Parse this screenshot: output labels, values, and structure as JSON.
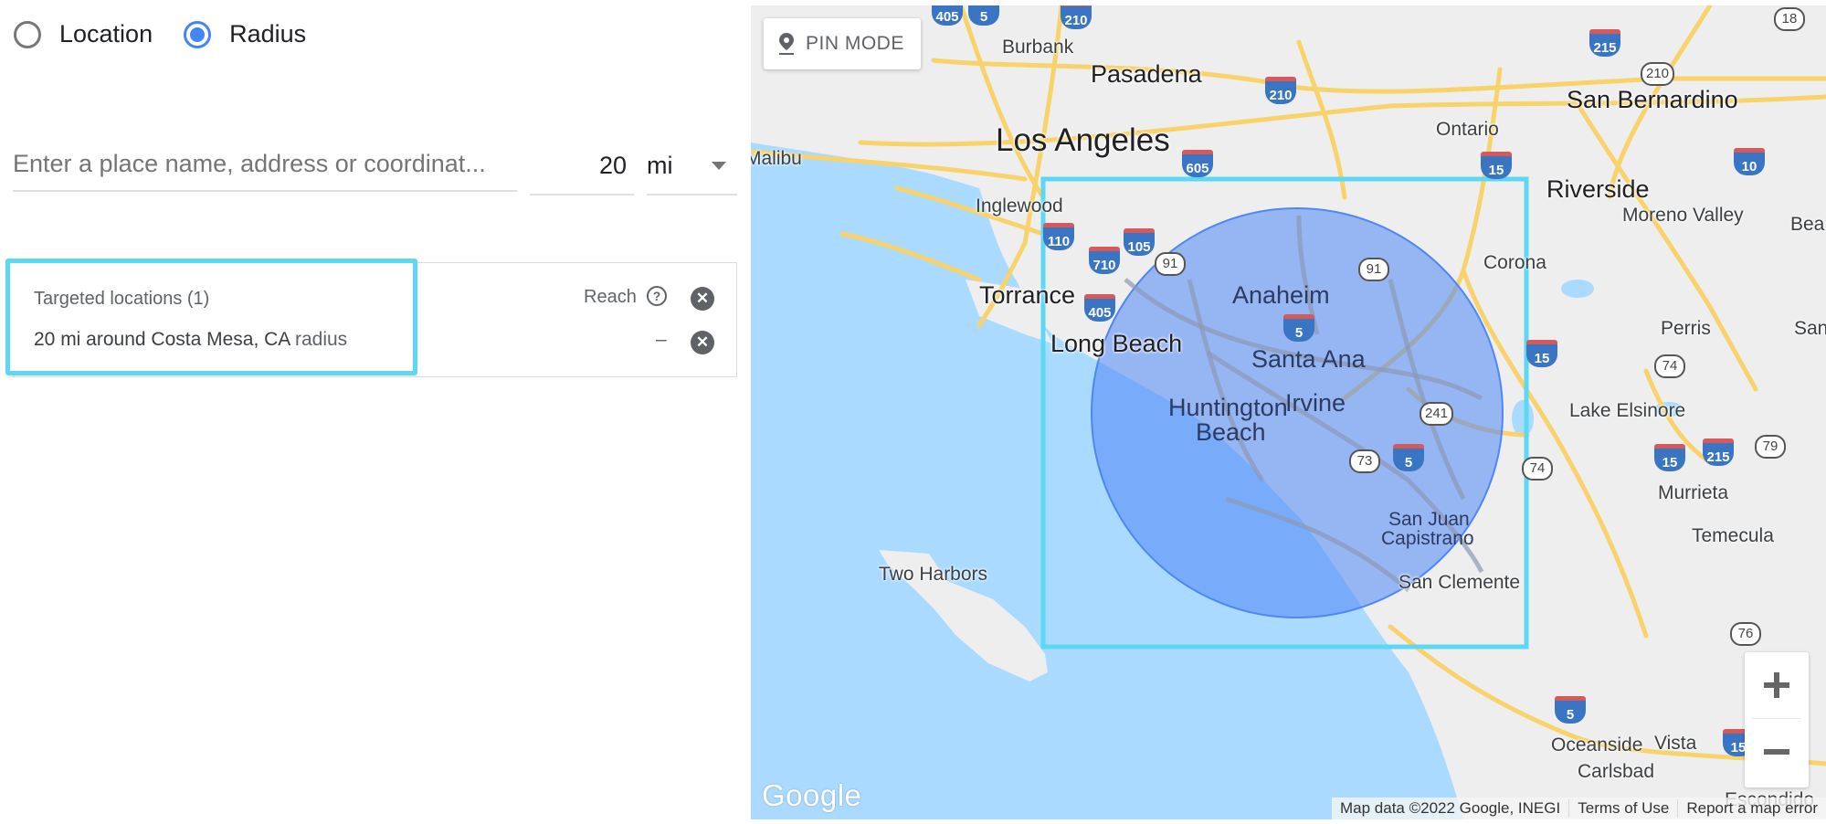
{
  "mode": {
    "options": [
      {
        "label": "Location",
        "selected": false
      },
      {
        "label": "Radius",
        "selected": true
      }
    ]
  },
  "search": {
    "placeholder": "Enter a place name, address or coordinat...",
    "value": ""
  },
  "radius": {
    "value": "20",
    "unit": "mi"
  },
  "targets": {
    "title": "Targeted locations (1)",
    "reach_label": "Reach",
    "help_icon": "question-circle-icon",
    "items": [
      {
        "text": "20 mi around Costa Mesa, CA",
        "suffix": "radius",
        "reach": "–"
      }
    ]
  },
  "map": {
    "pin_mode_label": "PIN MODE",
    "logo": "Google",
    "attribution": {
      "map_data": "Map data ©2022 Google, INEGI",
      "terms": "Terms of Use",
      "report": "Report a map error"
    },
    "zoom_in_icon": "plus-icon",
    "zoom_out_icon": "minus-icon",
    "radius_circle_color": "#4f86f7",
    "selection_box_color": "#5dd8f4",
    "water_color": "#aadaff",
    "cities": [
      {
        "name": "Burbank",
        "cls": ""
      },
      {
        "name": "Pasadena",
        "cls": "major"
      },
      {
        "name": "Los Angeles",
        "cls": "huge"
      },
      {
        "name": "Malibu",
        "cls": ""
      },
      {
        "name": "Inglewood",
        "cls": ""
      },
      {
        "name": "Torrance",
        "cls": "major"
      },
      {
        "name": "Long Beach",
        "cls": "major"
      },
      {
        "name": "Anaheim",
        "cls": "major in-circle"
      },
      {
        "name": "Santa Ana",
        "cls": "major in-circle"
      },
      {
        "name": "Irvine",
        "cls": "major in-circle"
      },
      {
        "name": "Huntington",
        "cls": "major in-circle"
      },
      {
        "name": "Beach",
        "cls": "major in-circle"
      },
      {
        "name": "San Juan",
        "cls": "in-circle"
      },
      {
        "name": "Capistrano",
        "cls": "in-circle"
      },
      {
        "name": "San Clemente",
        "cls": ""
      },
      {
        "name": "Two Harbors",
        "cls": ""
      },
      {
        "name": "Ontario",
        "cls": ""
      },
      {
        "name": "San Bernardino",
        "cls": "major"
      },
      {
        "name": "Riverside",
        "cls": "major"
      },
      {
        "name": "Moreno Valley",
        "cls": ""
      },
      {
        "name": "Corona",
        "cls": ""
      },
      {
        "name": "Perris",
        "cls": ""
      },
      {
        "name": "Lake Elsinore",
        "cls": ""
      },
      {
        "name": "Murrieta",
        "cls": ""
      },
      {
        "name": "Temecula",
        "cls": ""
      },
      {
        "name": "Oceanside",
        "cls": ""
      },
      {
        "name": "Vista",
        "cls": ""
      },
      {
        "name": "Carlsbad",
        "cls": ""
      },
      {
        "name": "Escondido",
        "cls": ""
      },
      {
        "name": "Bea",
        "cls": ""
      },
      {
        "name": "San",
        "cls": ""
      }
    ],
    "interstates": [
      "405",
      "5",
      "210",
      "210",
      "605",
      "110",
      "105",
      "710",
      "405",
      "5",
      "5",
      "15",
      "215",
      "10",
      "15",
      "15",
      "215",
      "5",
      "15"
    ],
    "state_routes": [
      "18",
      "210",
      "91",
      "91",
      "241",
      "73",
      "74",
      "74",
      "79",
      "76"
    ]
  }
}
